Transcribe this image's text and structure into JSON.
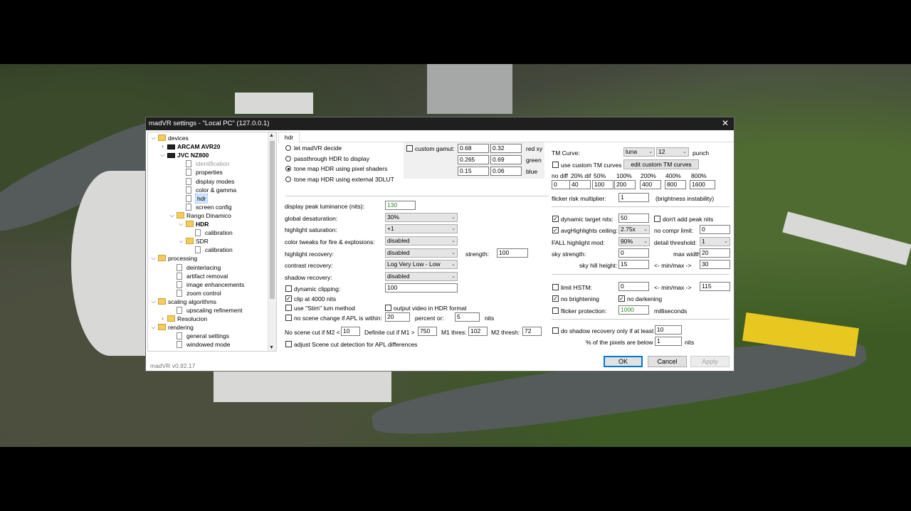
{
  "window": {
    "title": "madVR settings - \"Local PC\" (127.0.0.1)",
    "version": "madVR v0.92.17"
  },
  "tree": [
    {
      "label": "devices",
      "kind": "folder",
      "exp": "v",
      "bold": false,
      "selected": false,
      "dim": false
    },
    {
      "label": "ARCAM AVR20",
      "kind": "device",
      "exp": ">",
      "bold": true,
      "selected": false,
      "dim": false
    },
    {
      "label": "JVC NZ800",
      "kind": "device",
      "exp": "v",
      "bold": true,
      "selected": false,
      "dim": false
    },
    {
      "label": "identification",
      "kind": "file",
      "exp": "",
      "bold": false,
      "selected": false,
      "dim": true
    },
    {
      "label": "properties",
      "kind": "file",
      "exp": "",
      "bold": false,
      "selected": false,
      "dim": false
    },
    {
      "label": "display modes",
      "kind": "file",
      "exp": "",
      "bold": false,
      "selected": false,
      "dim": false
    },
    {
      "label": "color & gamma",
      "kind": "file",
      "exp": "",
      "bold": false,
      "selected": false,
      "dim": false
    },
    {
      "label": "hdr",
      "kind": "file",
      "exp": "",
      "bold": false,
      "selected": true,
      "dim": false
    },
    {
      "label": "screen config",
      "kind": "file",
      "exp": "",
      "bold": false,
      "selected": false,
      "dim": false
    },
    {
      "label": "Rango Dinamico",
      "kind": "folder",
      "exp": "v",
      "bold": false,
      "selected": false,
      "dim": false
    },
    {
      "label": "HDR",
      "kind": "folder",
      "exp": "v",
      "bold": true,
      "selected": false,
      "dim": false
    },
    {
      "label": "calibration",
      "kind": "file",
      "exp": "",
      "bold": false,
      "selected": false,
      "dim": false
    },
    {
      "label": "SDR",
      "kind": "folder",
      "exp": "v",
      "bold": false,
      "selected": false,
      "dim": false
    },
    {
      "label": "calibration",
      "kind": "file",
      "exp": "",
      "bold": false,
      "selected": false,
      "dim": false
    },
    {
      "label": "processing",
      "kind": "folder",
      "exp": "v",
      "bold": false,
      "selected": false,
      "dim": false
    },
    {
      "label": "deinterlacing",
      "kind": "file",
      "exp": "",
      "bold": false,
      "selected": false,
      "dim": false
    },
    {
      "label": "artifact removal",
      "kind": "file",
      "exp": "",
      "bold": false,
      "selected": false,
      "dim": false
    },
    {
      "label": "image enhancements",
      "kind": "file",
      "exp": "",
      "bold": false,
      "selected": false,
      "dim": false
    },
    {
      "label": "zoom control",
      "kind": "file",
      "exp": "",
      "bold": false,
      "selected": false,
      "dim": false
    },
    {
      "label": "scaling algorithms",
      "kind": "folder",
      "exp": "v",
      "bold": false,
      "selected": false,
      "dim": false
    },
    {
      "label": "upscaling refinement",
      "kind": "file",
      "exp": "",
      "bold": false,
      "selected": false,
      "dim": false
    },
    {
      "label": "Resolucion",
      "kind": "folder",
      "exp": ">",
      "bold": false,
      "selected": false,
      "dim": false
    },
    {
      "label": "rendering",
      "kind": "folder",
      "exp": "v",
      "bold": false,
      "selected": false,
      "dim": false
    },
    {
      "label": "general settings",
      "kind": "file",
      "exp": "",
      "bold": false,
      "selected": false,
      "dim": false
    },
    {
      "label": "windowed mode",
      "kind": "file",
      "exp": "",
      "bold": false,
      "selected": false,
      "dim": false
    }
  ],
  "tab": {
    "label": "hdr"
  },
  "mode": {
    "options": [
      "let madVR decide",
      "passthrough HDR to display",
      "tone map HDR using pixel shaders",
      "tone map HDR using external 3DLUT"
    ],
    "selected_index": 2
  },
  "gamut": {
    "label": "custom gamut:",
    "checked": false,
    "rows": [
      {
        "x": "0.68",
        "y": "0.32",
        "name": "red xy"
      },
      {
        "x": "0.265",
        "y": "0.69",
        "name": "green"
      },
      {
        "x": "0.15",
        "y": "0.06",
        "name": "blue"
      }
    ]
  },
  "left": {
    "display_peak": {
      "label": "display peak luminance (nits):",
      "value": "130"
    },
    "global_desat": {
      "label": "global desaturation:",
      "value": "30%"
    },
    "highlight_sat": {
      "label": "highlight saturation:",
      "value": "+1"
    },
    "color_tweaks": {
      "label": "color tweaks for fire & explosions:",
      "value": "disabled"
    },
    "highlight_recovery": {
      "label": "highlight recovery:",
      "value": "disabled"
    },
    "strength": {
      "label": "strength:",
      "value": "100"
    },
    "contrast_recovery": {
      "label": "contrast recovery:",
      "value": "Log Very Low - Low"
    },
    "shadow_recovery": {
      "label": "shadow recovery:",
      "value": "disabled"
    },
    "dynamic_clipping": {
      "label": "dynamic clipping:",
      "value": "100",
      "checked": false
    },
    "clip4000": {
      "label": "clip at 4000 nits",
      "checked": true
    },
    "stim": {
      "label": "use \"Stim\" lum method",
      "checked": false
    },
    "output_hdr": {
      "label": "output video in HDR format",
      "checked": false
    },
    "no_scene_change": {
      "label": "no scene change if APL is within:",
      "value": "20",
      "label2": "percent or:",
      "value2": "5",
      "unit": "nits",
      "checked": false
    },
    "scene_cut": {
      "label1": "No scene cut if M2 <",
      "v1": "10",
      "label2": "Definite cut if M1 >",
      "v2": "750",
      "label3": "M1 thres:",
      "v3": "102",
      "label4": "M2 thresh:",
      "v4": "72"
    },
    "adjust_cut": {
      "label": "adjust Scene cut detection for APL differences",
      "checked": false
    }
  },
  "right": {
    "tm_curve": {
      "label": "TM Curve:",
      "curve": "luna",
      "num": "12",
      "punch": "punch"
    },
    "custom_tm": {
      "label": "use custom TM curves",
      "checked": false,
      "button": "edit custom TM curves"
    },
    "levels": {
      "headers": [
        "no diff",
        "20% dif",
        "50%",
        "100%",
        "200%",
        "400%",
        "800%"
      ],
      "values": [
        "0",
        "40",
        "100",
        "200",
        "400",
        "800",
        "1600"
      ]
    },
    "flicker_risk": {
      "label": "flicker risk multiplier:",
      "value": "1",
      "note": "(brightness instability)"
    },
    "dyn_target": {
      "label": "dynamic target nits:",
      "value": "50",
      "checked": true
    },
    "dont_add_peak": {
      "label": "don't add peak nits",
      "checked": false
    },
    "avg_ceiling": {
      "label": "avgHighlights ceiling:",
      "value": "2.75x",
      "checked": true
    },
    "no_compr": {
      "label": "no compr limit:",
      "value": "0"
    },
    "fall_mod": {
      "label": "FALL highlight mod:",
      "value": "90%"
    },
    "detail_thresh": {
      "label": "detail threshold:",
      "value": "1"
    },
    "sky_strength": {
      "label": "sky strength:",
      "value": "0"
    },
    "max_width": {
      "label": "max width:",
      "value": "20"
    },
    "sky_hill": {
      "label": "sky hill height:",
      "value": "15",
      "minmax": "<- min/max ->",
      "value2": "30"
    },
    "limit_hstm": {
      "label": "limit HSTM:",
      "value": "0",
      "minmax": "<- min/max ->",
      "value2": "115",
      "checked": false
    },
    "no_bright": {
      "label": "no brightening",
      "checked": true
    },
    "no_dark": {
      "label": "no darkening",
      "checked": true
    },
    "flicker_prot": {
      "label": "flicker protection:",
      "value": "1000",
      "unit": "milliseconds",
      "checked": false
    },
    "shadow_only": {
      "label": "do shadow recovery only if at least",
      "value": "10",
      "checked": false
    },
    "pixels_below": {
      "label": "% of the pixels are below",
      "value": "1",
      "unit": "nits"
    }
  },
  "buttons": {
    "ok": "OK",
    "cancel": "Cancel",
    "apply": "Apply"
  }
}
